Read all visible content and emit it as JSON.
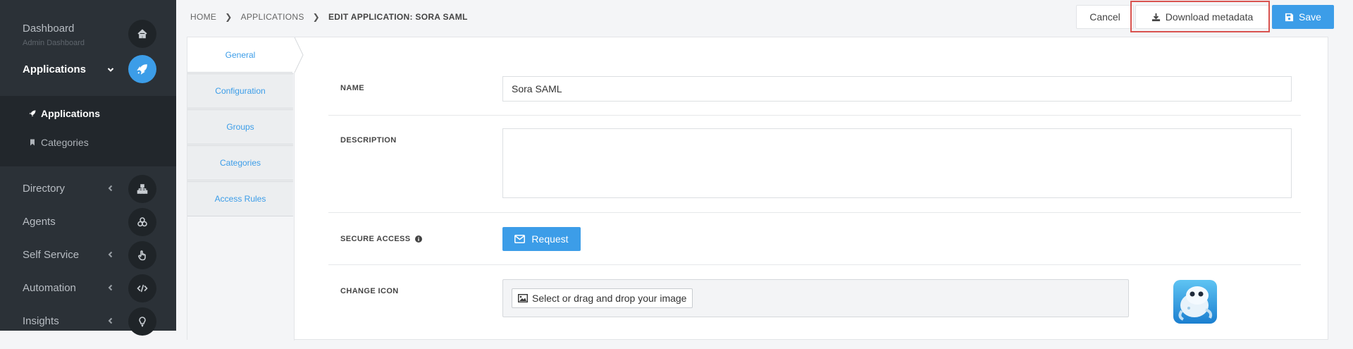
{
  "sidebar": {
    "dashboard": {
      "label": "Dashboard",
      "sublabel": "Admin Dashboard",
      "icon": "home-icon"
    },
    "applications": {
      "label": "Applications",
      "icon": "rocket-icon"
    },
    "submenu": [
      {
        "label": "Applications",
        "icon": "rocket-icon",
        "active": true
      },
      {
        "label": "Categories",
        "icon": "bookmark-icon",
        "active": false
      }
    ],
    "directory": {
      "label": "Directory",
      "icon": "sitemap-icon"
    },
    "agents": {
      "label": "Agents",
      "icon": "cogs-icon"
    },
    "self_service": {
      "label": "Self Service",
      "icon": "hand-pointer-icon"
    },
    "automation": {
      "label": "Automation",
      "icon": "code-icon"
    },
    "insights": {
      "label": "Insights",
      "icon": "lightbulb-icon"
    }
  },
  "breadcrumb": {
    "home": "HOME",
    "applications": "APPLICATIONS",
    "current": "EDIT APPLICATION: SORA SAML"
  },
  "toolbar": {
    "cancel_label": "Cancel",
    "download_label": "Download metadata",
    "save_label": "Save"
  },
  "tabs": [
    {
      "label": "General",
      "active": true
    },
    {
      "label": "Configuration",
      "active": false
    },
    {
      "label": "Groups",
      "active": false
    },
    {
      "label": "Categories",
      "active": false
    },
    {
      "label": "Access Rules",
      "active": false
    }
  ],
  "form": {
    "name": {
      "label": "NAME",
      "value": "Sora SAML"
    },
    "description": {
      "label": "DESCRIPTION",
      "value": ""
    },
    "secure_access": {
      "label": "SECURE ACCESS",
      "button_label": "Request",
      "info_icon": "info-circle-icon"
    },
    "change_icon": {
      "label": "CHANGE ICON",
      "button_label": "Select or drag and drop your image"
    }
  },
  "colors": {
    "accent": "#3c9de8",
    "sidebar_bg": "#2b3137",
    "highlight": "#d9534f"
  }
}
